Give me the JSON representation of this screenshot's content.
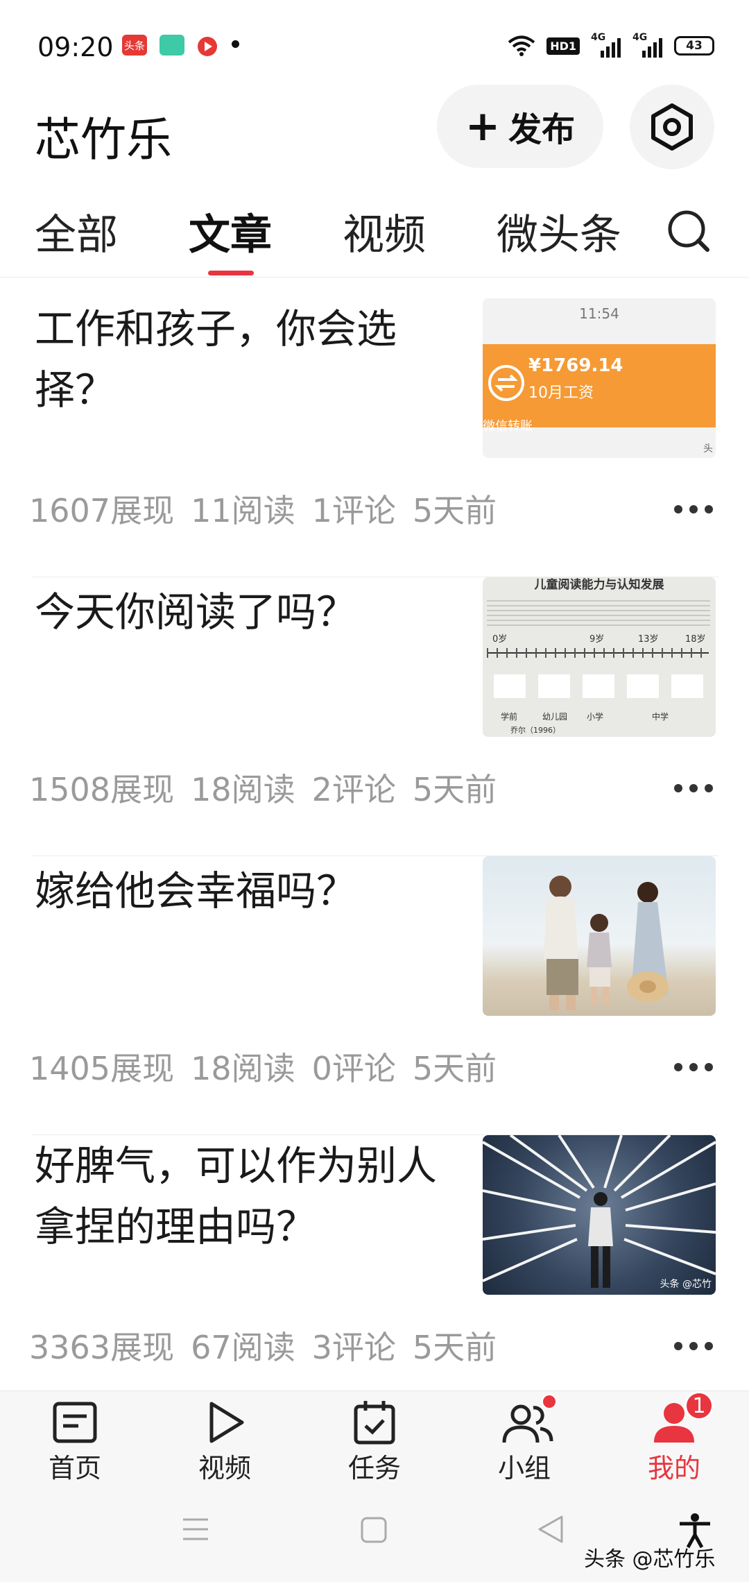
{
  "status_bar": {
    "time": "09:20",
    "battery": "43",
    "hd_label": "HD1",
    "sim1_label": "4G",
    "sim2_label": "4G",
    "app_icons": [
      "toutiao-icon",
      "green-app-icon",
      "red-video-icon"
    ]
  },
  "header": {
    "title": "芯竹乐",
    "publish_label": "发布"
  },
  "tabs": [
    {
      "label": "全部"
    },
    {
      "label": "文章"
    },
    {
      "label": "视频"
    },
    {
      "label": "微头条"
    }
  ],
  "active_tab_index": 1,
  "articles": [
    {
      "title": "工作和孩子，你会选择？",
      "stats": {
        "impressions": "1607展现",
        "reads": "11阅读",
        "comments": "1评论",
        "time": "5天前"
      },
      "thumb": {
        "time": "11:54",
        "amount": "¥1769.14",
        "caption": "10月工资",
        "note": "微信转账",
        "corner": "头"
      }
    },
    {
      "title": "今天你阅读了吗？",
      "stats": {
        "impressions": "1508展现",
        "reads": "18阅读",
        "comments": "2评论",
        "time": "5天前"
      },
      "thumb": {
        "heading": "儿童阅读能力与认知发展",
        "marks": [
          "0岁",
          "9岁",
          "13岁",
          "18岁"
        ],
        "labels": [
          "学前",
          "幼儿园",
          "小学",
          "中学"
        ],
        "source": "乔尔（1996）"
      }
    },
    {
      "title": "嫁给他会幸福吗？",
      "stats": {
        "impressions": "1405展现",
        "reads": "18阅读",
        "comments": "0评论",
        "time": "5天前"
      },
      "thumb": {}
    },
    {
      "title": "好脾气，可以作为别人拿捏的理由吗？",
      "stats": {
        "impressions": "3363展现",
        "reads": "67阅读",
        "comments": "3评论",
        "time": "5天前"
      },
      "thumb": {
        "watermark": "头条 @芯竹"
      }
    }
  ],
  "bottom_nav": [
    {
      "label": "首页",
      "icon": "home-icon"
    },
    {
      "label": "视频",
      "icon": "video-play-icon"
    },
    {
      "label": "任务",
      "icon": "task-calendar-icon"
    },
    {
      "label": "小组",
      "icon": "group-icon"
    },
    {
      "label": "我的",
      "icon": "profile-icon",
      "badge": "1"
    }
  ],
  "watermark": "头条 @芯竹乐",
  "colors": {
    "accent": "#e8353f",
    "meta": "#9a9a9a",
    "bg": "#ffffff"
  }
}
